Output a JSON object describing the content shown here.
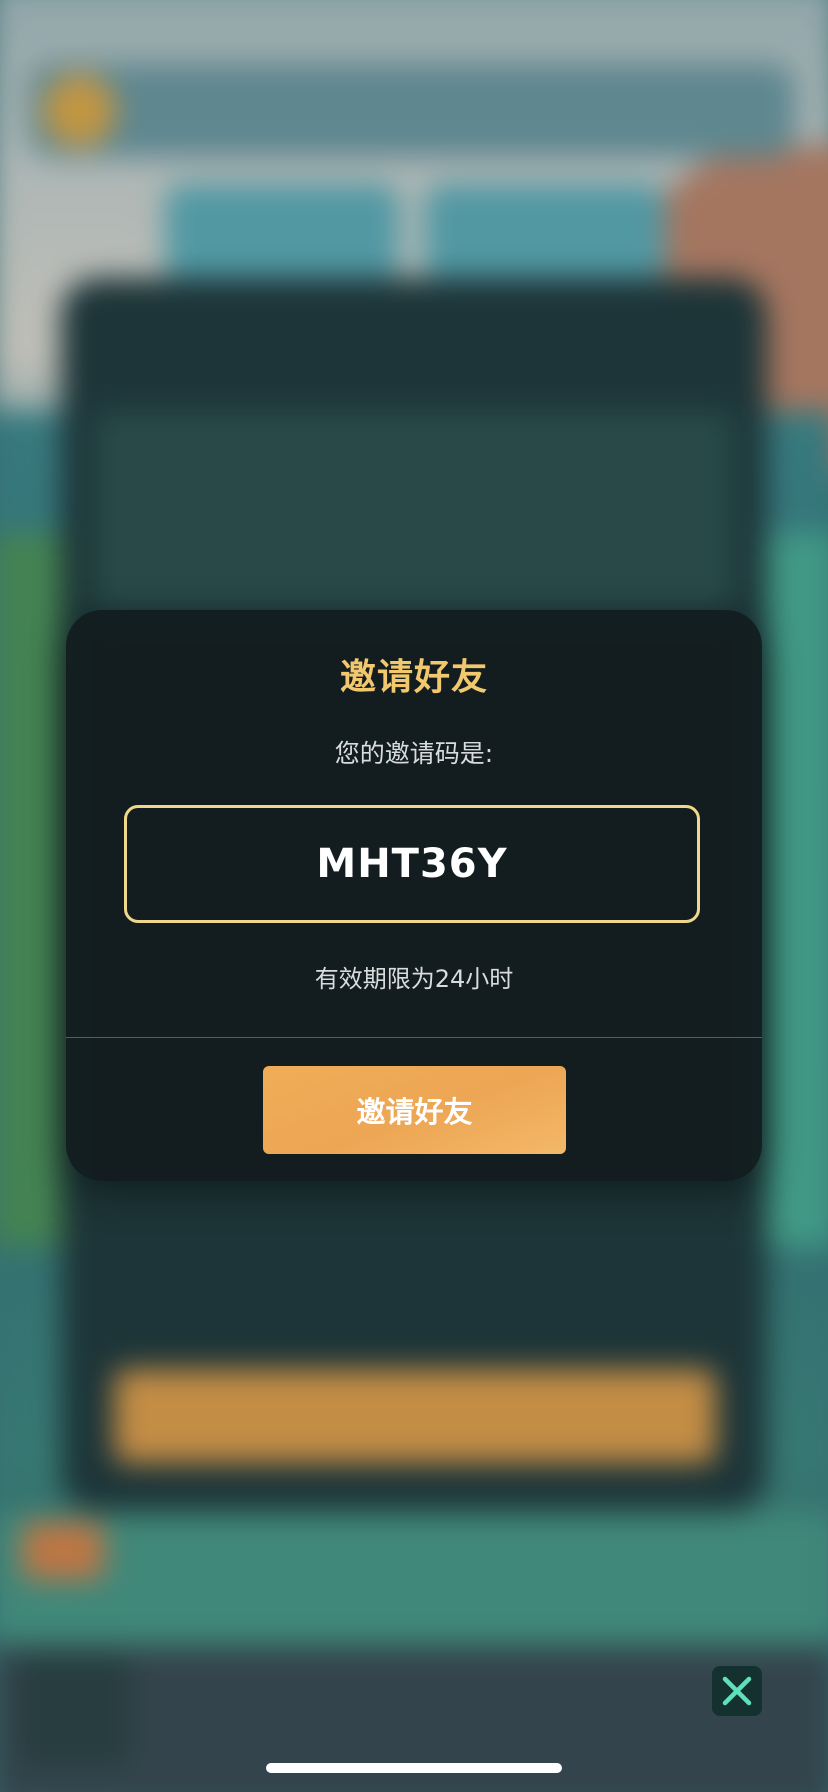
{
  "dialog": {
    "title": "邀请好友",
    "subtitle": "您的邀请码是:",
    "invite_code": "MHT36Y",
    "validity_note": "有效期限为24小时",
    "button_label": "邀请好友"
  },
  "close_button": {
    "icon": "close-icon"
  },
  "colors": {
    "title_gold": "#f2c86e",
    "code_border": "#f1d78b",
    "button_orange": "#eea755",
    "close_icon": "#5ee0b9",
    "dialog_bg": "#121c1e"
  }
}
